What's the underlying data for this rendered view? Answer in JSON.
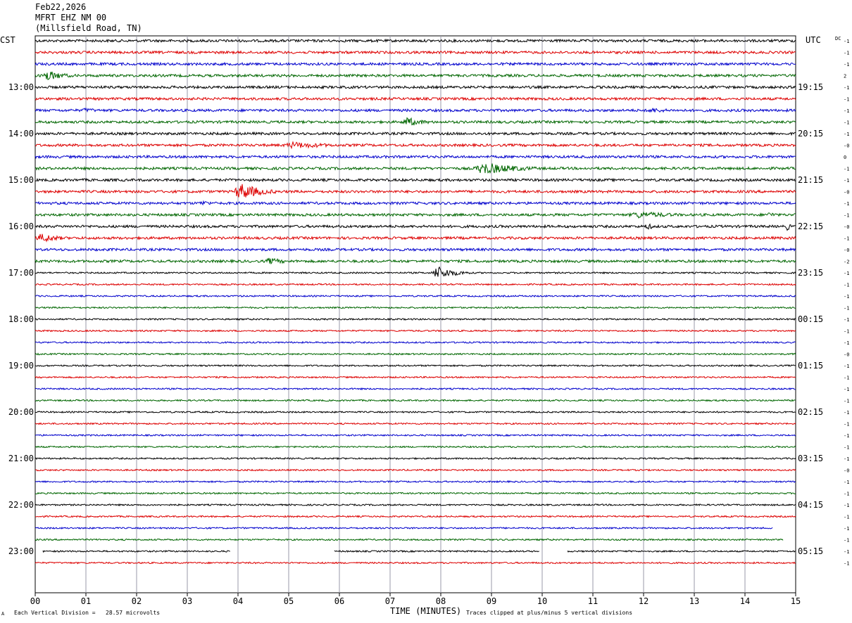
{
  "header": {
    "date": "Feb22,2026",
    "station": "MFRT EHZ NM 00",
    "location": "(Millsfield Road, TN)"
  },
  "footer": {
    "scale_note": "Each Vertical Division =   28.57 microvolts",
    "xlabel": "TIME (MINUTES)",
    "clip_note": "Traces clipped at plus/minus 5 vertical divisions",
    "corner_mark": "A"
  },
  "colors": {
    "black": "#000000",
    "red": "#dd0000",
    "blue": "#0000cc",
    "green": "#006600",
    "grid": "#9a9aa8"
  },
  "chart_data": {
    "type": "line",
    "subtype": "helicorder",
    "title": "Feb22,2026 MFRT EHZ NM 00 (Millsfield Road, TN)",
    "xlabel": "TIME (MINUTES)",
    "xlim": [
      0,
      15
    ],
    "x_ticks": [
      "00",
      "01",
      "02",
      "03",
      "04",
      "05",
      "06",
      "07",
      "08",
      "09",
      "10",
      "11",
      "12",
      "13",
      "14",
      "15"
    ],
    "left_axis_title": "CST",
    "right_axis_title": "UTC",
    "dc_label": "DC",
    "left_hour_labels": [
      "13:00",
      "14:00",
      "15:00",
      "16:00",
      "17:00",
      "18:00",
      "19:00",
      "20:00",
      "21:00",
      "22:00",
      "23:00"
    ],
    "right_hour_labels": [
      "19:15",
      "20:15",
      "21:15",
      "22:15",
      "23:15",
      "00:15",
      "01:15",
      "02:15",
      "03:15",
      "04:15",
      "05:15"
    ],
    "first_hour_label_row": 4,
    "rows_per_hour": 4,
    "trace_color_cycle": [
      "black",
      "red",
      "blue",
      "green"
    ],
    "dc_offsets": [
      "-1",
      "-1",
      "-1",
      "2",
      "-1",
      "-1",
      "-1",
      "-1",
      "-1",
      "-0",
      "0",
      "-1",
      "-1",
      "-0",
      "-1",
      "-1",
      "-0",
      "-1",
      "-0",
      "-2",
      "-1",
      "-1",
      "-1",
      "-1",
      "-1",
      "-1",
      "-1",
      "-0",
      "-1",
      "-1",
      "-1",
      "-1",
      "-1",
      "-1",
      "-1",
      "-1",
      "-1",
      "-0",
      "-1",
      "-1",
      "-1",
      "-1",
      "-1",
      "-1",
      "-1",
      "-1"
    ],
    "events": [
      {
        "row": 3,
        "start_min": 0.1,
        "end_min": 0.9,
        "amp": 8
      },
      {
        "row": 6,
        "start_min": 0.9,
        "end_min": 1.5,
        "amp": 4
      },
      {
        "row": 6,
        "start_min": 12.0,
        "end_min": 13.0,
        "amp": 4
      },
      {
        "row": 7,
        "start_min": 7.2,
        "end_min": 8.0,
        "amp": 7
      },
      {
        "row": 9,
        "start_min": 4.8,
        "end_min": 6.7,
        "amp": 5
      },
      {
        "row": 10,
        "start_min": 11.8,
        "end_min": 12.2,
        "amp": 4
      },
      {
        "row": 11,
        "start_min": 8.6,
        "end_min": 10.2,
        "amp": 9
      },
      {
        "row": 13,
        "start_min": 3.9,
        "end_min": 4.8,
        "amp": 13
      },
      {
        "row": 14,
        "start_min": 3.2,
        "end_min": 3.8,
        "amp": 4
      },
      {
        "row": 15,
        "start_min": 11.6,
        "end_min": 13.5,
        "amp": 5
      },
      {
        "row": 15,
        "start_min": 14.4,
        "end_min": 14.9,
        "amp": 4
      },
      {
        "row": 16,
        "start_min": 12.0,
        "end_min": 12.4,
        "amp": 5
      },
      {
        "row": 16,
        "start_min": 14.8,
        "end_min": 15.0,
        "amp": 6
      },
      {
        "row": 17,
        "start_min": 0.0,
        "end_min": 0.8,
        "amp": 7
      },
      {
        "row": 19,
        "start_min": 4.5,
        "end_min": 5.3,
        "amp": 5
      },
      {
        "row": 20,
        "start_min": 7.8,
        "end_min": 8.6,
        "amp": 10
      }
    ],
    "partial_rows": [
      {
        "row": 42,
        "segments": [
          [
            0,
            14.55
          ]
        ]
      },
      {
        "row": 43,
        "segments": [
          [
            0,
            14.75
          ]
        ]
      },
      {
        "row": 44,
        "segments": [
          [
            0.15,
            3.85
          ],
          [
            5.9,
            9.95
          ],
          [
            10.5,
            15.0
          ]
        ]
      }
    ]
  }
}
